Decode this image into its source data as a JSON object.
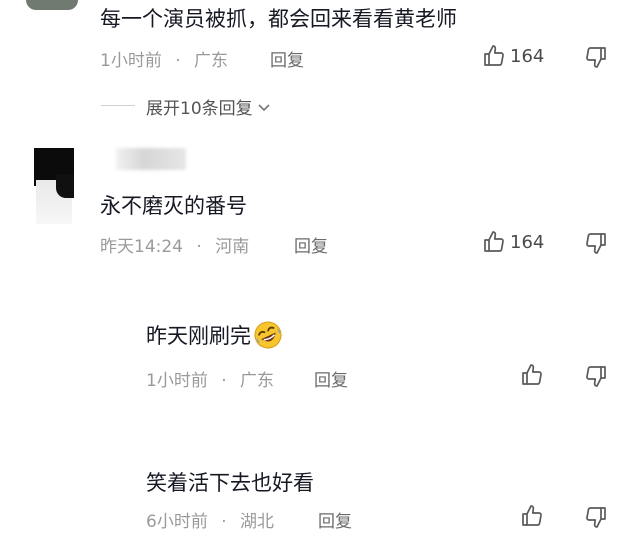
{
  "comment1": {
    "text": "每一个演员被抓，都会回来看看黄老师",
    "time": "1小时前",
    "location": "广东",
    "reply_label": "回复",
    "like_count": "164",
    "expand_label": "展开10条回复"
  },
  "comment2": {
    "text": "永不磨灭的番号",
    "time": "昨天14:24",
    "location": "河南",
    "reply_label": "回复",
    "like_count": "164"
  },
  "reply1": {
    "text": "昨天刚刷完",
    "emoji": "rolling-laughing-emoji",
    "time": "1小时前",
    "location": "广东",
    "reply_label": "回复"
  },
  "reply2": {
    "text": "笑着活下去也好看",
    "time": "6小时前",
    "location": "湖北",
    "reply_label": "回复"
  },
  "separator": "·",
  "icons": {
    "like": "thumbs-up-icon",
    "dislike": "thumbs-down-icon",
    "expand": "chevron-down-icon"
  }
}
